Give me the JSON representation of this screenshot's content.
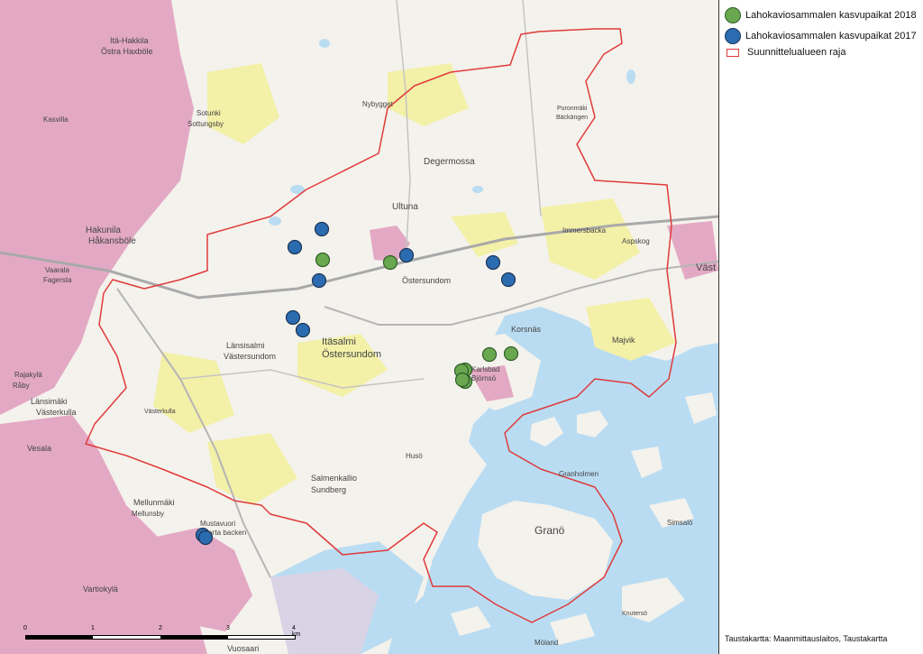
{
  "legend": {
    "items": [
      {
        "label": "Lahokaviosammalen kasvupaikat 2018",
        "symbol": "circle",
        "color": "#6aa84f"
      },
      {
        "label": "Lahokaviosammalen kasvupaikat 2017",
        "symbol": "circle",
        "color": "#2b6cb0"
      },
      {
        "label": "Suunnittelualueen raja",
        "symbol": "outline",
        "color": "#e03a3a"
      }
    ]
  },
  "credit": "Taustakartta: Maanmittauslaitos, Taustakartta",
  "scalebar": {
    "labels": [
      "0",
      "1",
      "2",
      "3",
      "4 km"
    ]
  },
  "colors": {
    "land": "#f4f2ec",
    "water": "#b9dcf2",
    "urban": "#e3a9c4",
    "field": "#f3f0a8",
    "boundary": "#e03a3a"
  },
  "place_labels": [
    {
      "text": "Itä-Hakkila",
      "size": 9
    },
    {
      "text": "Östra Haxböle",
      "size": 9
    },
    {
      "text": "Kasvilla",
      "size": 8
    },
    {
      "text": "Sotunki",
      "size": 8
    },
    {
      "text": "Sottungsby",
      "size": 8
    },
    {
      "text": "Hakunila",
      "size": 10
    },
    {
      "text": "Håkansböle",
      "size": 10
    },
    {
      "text": "Vaarala",
      "size": 8
    },
    {
      "text": "Fagersta",
      "size": 8
    },
    {
      "text": "Rajakylä",
      "size": 8
    },
    {
      "text": "Råby",
      "size": 8
    },
    {
      "text": "Länsimäki",
      "size": 9
    },
    {
      "text": "Västerkulla",
      "size": 9
    },
    {
      "text": "Vesala",
      "size": 9
    },
    {
      "text": "Mellunmäki",
      "size": 9
    },
    {
      "text": "Mellunsby",
      "size": 8
    },
    {
      "text": "Vartiokylä",
      "size": 9
    },
    {
      "text": "Nybygget",
      "size": 8
    },
    {
      "text": "Degermossa",
      "size": 10
    },
    {
      "text": "Ultuna",
      "size": 10
    },
    {
      "text": "Östersundom",
      "size": 9
    },
    {
      "text": "Itäsalmi",
      "size": 11
    },
    {
      "text": "Östersundom",
      "size": 11
    },
    {
      "text": "Länsisalmi",
      "size": 9
    },
    {
      "text": "Västersundom",
      "size": 9
    },
    {
      "text": "Korsnäs",
      "size": 9
    },
    {
      "text": "Karlsbad",
      "size": 8
    },
    {
      "text": "Björnsö",
      "size": 8
    },
    {
      "text": "Majvik",
      "size": 9
    },
    {
      "text": "Immersbacka",
      "size": 8
    },
    {
      "text": "Salmenkallio",
      "size": 9
    },
    {
      "text": "Sundberg",
      "size": 9
    },
    {
      "text": "Husö",
      "size": 8
    },
    {
      "text": "Granö",
      "size": 12
    },
    {
      "text": "Puronmäki",
      "size": 7
    },
    {
      "text": "Bäckängen",
      "size": 7
    },
    {
      "text": "Västerkulla",
      "size": 7
    },
    {
      "text": "Mustavuori",
      "size": 8
    },
    {
      "text": "Svarta backen",
      "size": 8
    },
    {
      "text": "Vuosaari",
      "size": 9
    },
    {
      "text": "Möland",
      "size": 8
    },
    {
      "text": "Granholmen",
      "size": 8
    },
    {
      "text": "Simsalö",
      "size": 8
    },
    {
      "text": "Knutersö",
      "size": 7
    },
    {
      "text": "Aspskog",
      "size": 8
    },
    {
      "text": "Väst",
      "size": 11
    }
  ]
}
